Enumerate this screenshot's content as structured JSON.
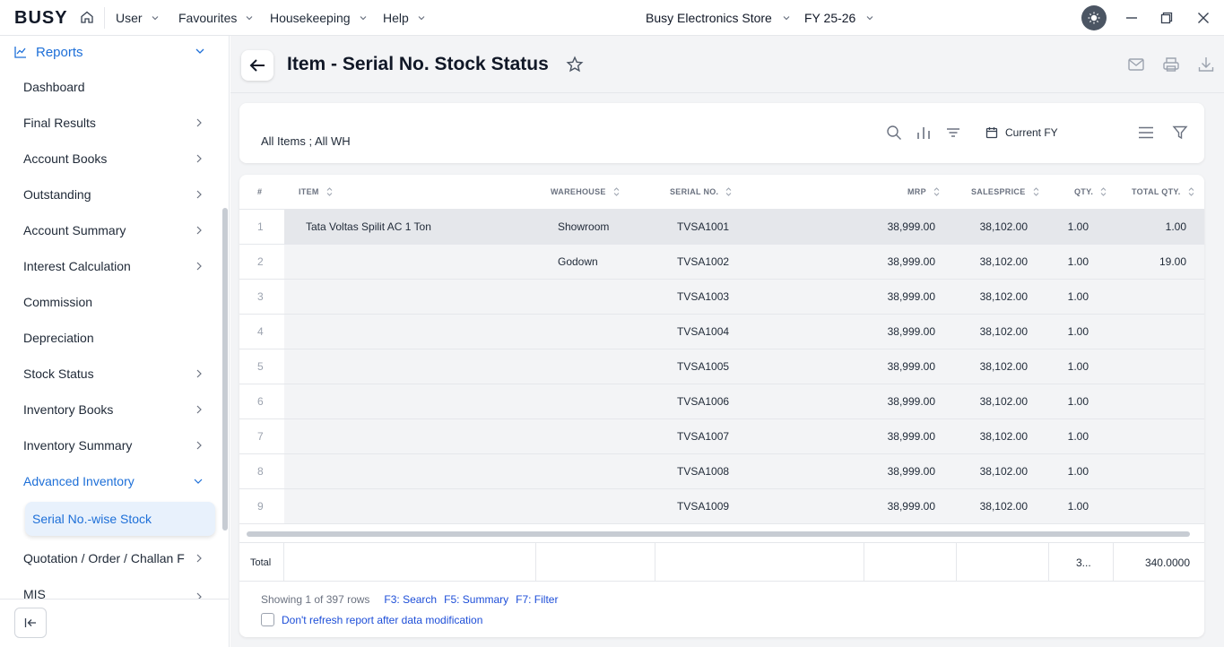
{
  "topbar": {
    "logo": "BUSY",
    "menus": [
      "User",
      "Favourites",
      "Housekeeping",
      "Help"
    ],
    "company": "Busy Electronics Store",
    "fy": "FY 25-26"
  },
  "sidebar": {
    "section": "Reports",
    "items": [
      {
        "label": "Dashboard"
      },
      {
        "label": "Final Results"
      },
      {
        "label": "Account Books"
      },
      {
        "label": "Outstanding"
      },
      {
        "label": "Account Summary"
      },
      {
        "label": "Interest Calculation"
      },
      {
        "label": "Commission"
      },
      {
        "label": "Depreciation"
      },
      {
        "label": "Stock Status"
      },
      {
        "label": "Inventory Books"
      },
      {
        "label": "Inventory Summary"
      },
      {
        "label": "Advanced Inventory"
      },
      {
        "label": "Quotation / Order / Challan F"
      },
      {
        "label": "MIS"
      }
    ],
    "active_sub": "Serial No.-wise Stock"
  },
  "page": {
    "title": "Item - Serial No. Stock Status",
    "filter_text": "All Items ; All WH",
    "period": "Current FY"
  },
  "table": {
    "headers": [
      "#",
      "ITEM",
      "WAREHOUSE",
      "SERIAL NO.",
      "MRP",
      "SALESPRICE",
      "QTY.",
      "TOTAL QTY."
    ],
    "rows": [
      {
        "n": "1",
        "item": "Tata Voltas Spilit AC 1 Ton",
        "wh": "Showroom",
        "serial": "TVSA1001",
        "mrp": "38,999.00",
        "sp": "38,102.00",
        "qty": "1.00",
        "total": "1.00"
      },
      {
        "n": "2",
        "item": "",
        "wh": "Godown",
        "serial": "TVSA1002",
        "mrp": "38,999.00",
        "sp": "38,102.00",
        "qty": "1.00",
        "total": "19.00"
      },
      {
        "n": "3",
        "item": "",
        "wh": "",
        "serial": "TVSA1003",
        "mrp": "38,999.00",
        "sp": "38,102.00",
        "qty": "1.00",
        "total": ""
      },
      {
        "n": "4",
        "item": "",
        "wh": "",
        "serial": "TVSA1004",
        "mrp": "38,999.00",
        "sp": "38,102.00",
        "qty": "1.00",
        "total": ""
      },
      {
        "n": "5",
        "item": "",
        "wh": "",
        "serial": "TVSA1005",
        "mrp": "38,999.00",
        "sp": "38,102.00",
        "qty": "1.00",
        "total": ""
      },
      {
        "n": "6",
        "item": "",
        "wh": "",
        "serial": "TVSA1006",
        "mrp": "38,999.00",
        "sp": "38,102.00",
        "qty": "1.00",
        "total": ""
      },
      {
        "n": "7",
        "item": "",
        "wh": "",
        "serial": "TVSA1007",
        "mrp": "38,999.00",
        "sp": "38,102.00",
        "qty": "1.00",
        "total": ""
      },
      {
        "n": "8",
        "item": "",
        "wh": "",
        "serial": "TVSA1008",
        "mrp": "38,999.00",
        "sp": "38,102.00",
        "qty": "1.00",
        "total": ""
      },
      {
        "n": "9",
        "item": "",
        "wh": "",
        "serial": "TVSA1009",
        "mrp": "38,999.00",
        "sp": "38,102.00",
        "qty": "1.00",
        "total": ""
      }
    ],
    "total_label": "Total",
    "total_qty": "3...",
    "total_total_qty": "340.0000"
  },
  "footer": {
    "showing": "Showing 1 of 397 rows",
    "shortcut_search": "F3: Search",
    "shortcut_summary": "F5: Summary",
    "shortcut_filter": "F7: Filter",
    "refresh_label": "Don't refresh report after data modification"
  },
  "colors": {
    "accent": "#1d6fd8",
    "link": "#1d4ed8",
    "selected_row": "#e5e7eb"
  }
}
